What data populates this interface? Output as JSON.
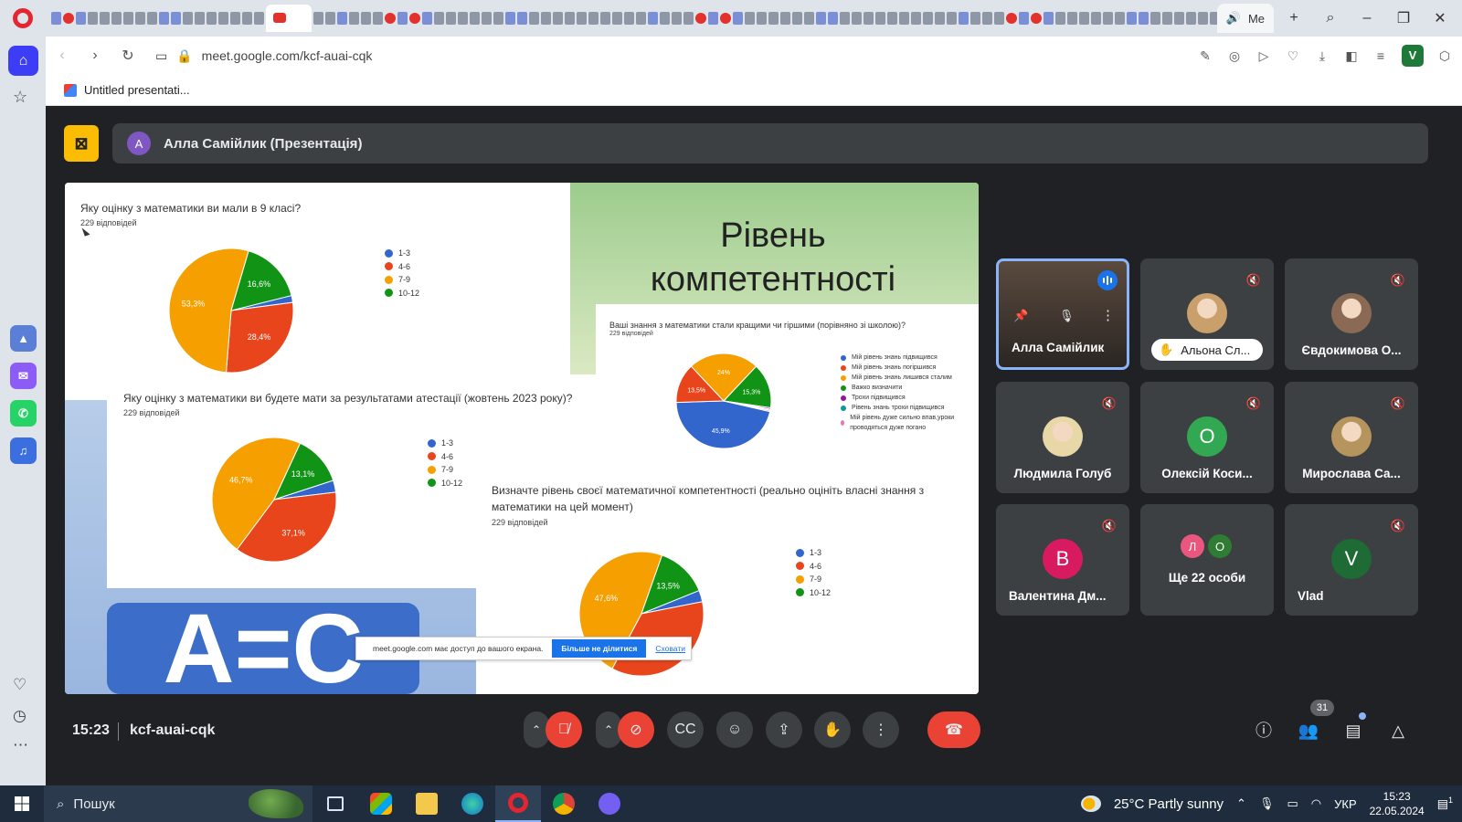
{
  "browser": {
    "tab_active_label": "Me",
    "url": "meet.google.com/kcf-auai-cqk",
    "bookmark": "Untitled presentati..."
  },
  "meet": {
    "presenter_initial": "A",
    "presenter_title": "Алла Самійлик (Презентація)",
    "time": "15:23",
    "meeting_code": "kcf-auai-cqk",
    "participant_count": "31",
    "participants": [
      {
        "name": "Алла Самійлик",
        "type": "video",
        "speaking": true
      },
      {
        "name": "Альона Сл...",
        "type": "photo",
        "hand_raised": true,
        "photo_color": "#c9a06b"
      },
      {
        "name": "Євдокимова О...",
        "type": "photo",
        "photo_color": "#8a6a55"
      },
      {
        "name": "Людмила Голуб",
        "type": "photo",
        "muted": true,
        "photo_color": "#e8d8a8"
      },
      {
        "name": "Олексій Коси...",
        "type": "initial",
        "initial": "О",
        "color": "#33a852",
        "muted": true
      },
      {
        "name": "Мирослава Са...",
        "type": "photo",
        "muted": true,
        "photo_color": "#b6945d"
      },
      {
        "name": "Валентина Дм...",
        "type": "initial",
        "initial": "В",
        "color": "#d81b60",
        "muted": true
      },
      {
        "name": "Ще 22 особи",
        "type": "group",
        "initials": [
          "Л",
          "О"
        ],
        "colors": [
          "#e9577f",
          "#2e7d32"
        ]
      },
      {
        "name": "Vlad",
        "type": "initial",
        "initial": "V",
        "color": "#1e6b35",
        "muted": true
      }
    ]
  },
  "slide": {
    "title_line1": "Рівень",
    "title_line2": "компетентності",
    "ac_text": "A=C",
    "responses": "229 відповідей",
    "q1": "Яку оцінку з математики ви мали в 9 класі?",
    "q2": "Яку оцінку з математики ви будете мати за результатами  атестації (жовтень 2023 року)?",
    "q3": "Ваші знання з математики стали кращими чи гіршими (порівняно зі школою)?",
    "q4_line1": "Визначте рівень своєї математичної компетентності (реально оцініть власні знання з",
    "q4_line2": "математики на цей момент)",
    "grade_legend": [
      "1-3",
      "4-6",
      "7-9",
      "10-12"
    ],
    "change_legend": [
      "Мій рівень знань підвищився",
      "Мій рівень знань погіршився",
      "Мій рівень знань лишився сталим",
      "Важко визначити",
      "Трохи підвищився",
      "Рівень знань трохи підвищився",
      "Мій рівень дуже сильно впав,уроки проводяться дуже погано"
    ],
    "share_notice": "meet.google.com має доступ до вашого екрана.",
    "share_stop": "Більше не ділитися",
    "share_hide": "Сховати"
  },
  "colors": {
    "blue": "#3366cc",
    "red": "#e8451c",
    "orange": "#f5a000",
    "green": "#119416",
    "teal": "#11969a",
    "purple": "#991199",
    "pink": "#e67ab0"
  },
  "chart_data": [
    {
      "type": "pie",
      "title": "Яку оцінку з математики ви мали в 9 класі?",
      "labels": [
        "1-3",
        "4-6",
        "7-9",
        "10-12"
      ],
      "values": [
        1.8,
        28.4,
        53.3,
        16.6
      ],
      "value_labels": [
        "",
        "28,4%",
        "53,3%",
        "16,6%"
      ]
    },
    {
      "type": "pie",
      "title": "Яку оцінку з математики ви будете мати за результатами  атестації (жовтень 2023 року)?",
      "labels": [
        "1-3",
        "4-6",
        "7-9",
        "10-12"
      ],
      "values": [
        3.1,
        37.1,
        46.7,
        13.1
      ],
      "value_labels": [
        "",
        "37,1%",
        "46,7%",
        "13,1%"
      ]
    },
    {
      "type": "pie",
      "title": "Ваші знання з математики стали кращими чи гіршими (порівняно зі школою)?",
      "labels": [
        "Мій рівень знань підвищився",
        "Мій рівень знань погіршився",
        "Мій рівень знань лишився сталим",
        "Важко визначити",
        "Трохи підвищився",
        "Рівень знань трохи підвищився",
        "Мій рівень дуже сильно впав,уроки проводяться дуже погано"
      ],
      "values": [
        45.9,
        13.5,
        24,
        15.3,
        0.5,
        0.4,
        0.4
      ],
      "value_labels": [
        "45,9%",
        "13,5%",
        "24%",
        "15,3%",
        "",
        "",
        ""
      ]
    },
    {
      "type": "pie",
      "title": "Визначте рівень своєї математичної компетентності (реально оцініть власні знання з математики на цей момент)",
      "labels": [
        "1-3",
        "4-6",
        "7-9",
        "10-12"
      ],
      "values": [
        3.0,
        35.9,
        47.6,
        13.5
      ],
      "value_labels": [
        "",
        "",
        "47,6%",
        "13,5%"
      ]
    }
  ],
  "taskbar": {
    "search": "Пошук",
    "weather": "25°C  Partly sunny",
    "lang": "УКР",
    "time": "15:23",
    "date": "22.05.2024",
    "notif": "1"
  }
}
